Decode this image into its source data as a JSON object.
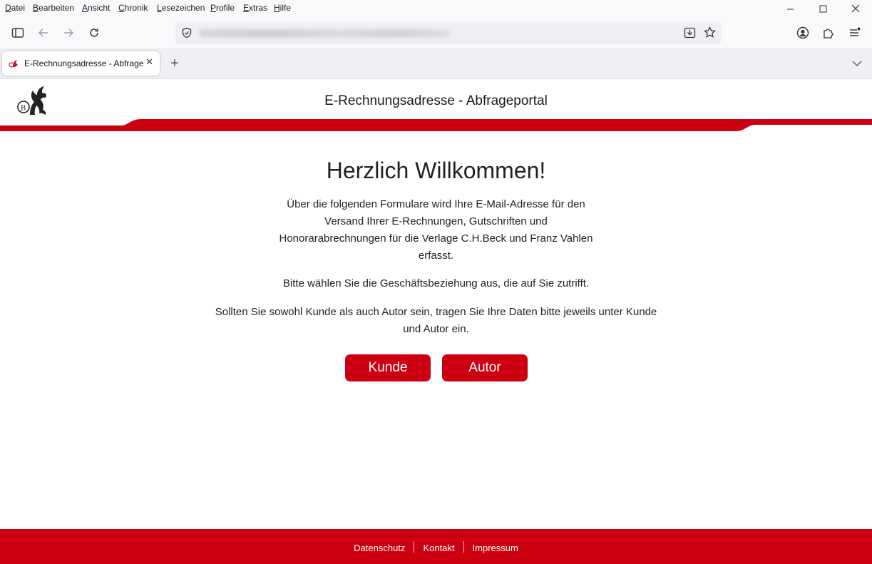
{
  "browser": {
    "menu": [
      {
        "first": "D",
        "rest": "atei"
      },
      {
        "first": "B",
        "rest": "earbeiten"
      },
      {
        "first": "A",
        "rest": "nsicht"
      },
      {
        "first": "C",
        "rest": "hronik"
      },
      {
        "first": "L",
        "rest": "esezeichen"
      },
      {
        "first": "P",
        "rest": "rofile"
      },
      {
        "first": "E",
        "rest": "xtras"
      },
      {
        "first": "H",
        "rest": "ilfe"
      }
    ],
    "tab": {
      "title": "E-Rechnungsadresse - Abfrageportal",
      "close": "✕"
    },
    "new_tab": "+"
  },
  "header": {
    "portal_title": "E-Rechnungsadresse - Abfrageportal"
  },
  "main": {
    "welcome": "Herzlich Willkommen!",
    "intro": "Über die folgenden Formulare wird Ihre E-Mail-Adresse für den Versand Ihrer E-Rechnungen, Gutschriften und Honorarabrechnungen für die Verlage C.H.Beck und Franz Vahlen erfasst.",
    "choose": "Bitte wählen Sie die Geschäftsbeziehung aus, die auf Sie zutrifft.",
    "both": "Sollten Sie sowohl Kunde als auch Autor sein, tragen Sie Ihre Daten bitte jeweils unter Kunde und Autor ein.",
    "buttons": {
      "customer": "Kunde",
      "author": "Autor"
    }
  },
  "footer": {
    "links": [
      "Datenschutz",
      "Kontakt",
      "Impressum"
    ]
  },
  "colors": {
    "brand_red": "#cc0011"
  }
}
